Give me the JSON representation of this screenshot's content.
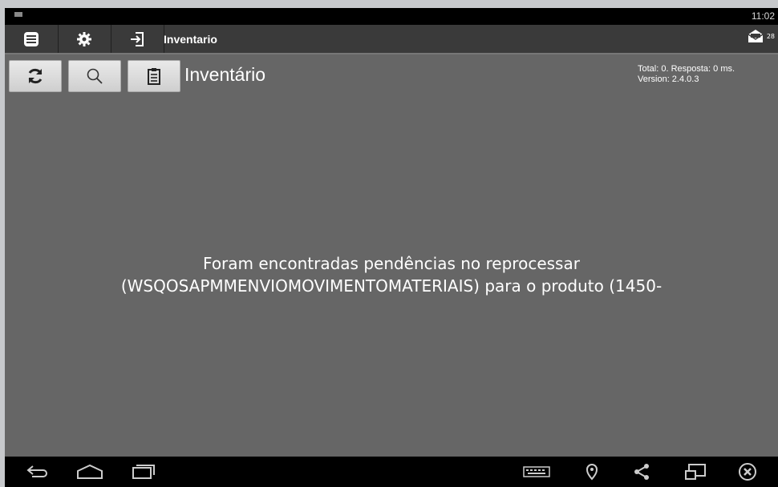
{
  "status_bar": {
    "time": "11:02"
  },
  "action_bar": {
    "title": "Inventario",
    "mail_count": "28"
  },
  "toolbar": {
    "heading": "Inventário"
  },
  "info": {
    "line1": "Total: 0. Resposta: 0 ms.",
    "line2": "Version: 2.4.0.3"
  },
  "message": {
    "line1": "Foram encontradas pendências no reprocessar",
    "line2": "(WSQOSAPMMENVIOMOVIMENTOMATERIAIS) para o produto (1450-"
  },
  "icons": {
    "menu": "list-icon",
    "settings": "gear-icon",
    "login": "login-icon",
    "mail": "mail-icon",
    "refresh": "refresh-icon",
    "search": "search-icon",
    "clipboard": "clipboard-icon",
    "back": "back-icon",
    "home": "home-icon",
    "recents": "recents-icon",
    "keyboard": "keyboard-icon",
    "location": "location-icon",
    "share": "share-icon",
    "window": "window-icon",
    "close": "close-icon"
  },
  "colors": {
    "background": "#666666",
    "actionbar": "#3a3a3a",
    "text": "#ffffff"
  }
}
